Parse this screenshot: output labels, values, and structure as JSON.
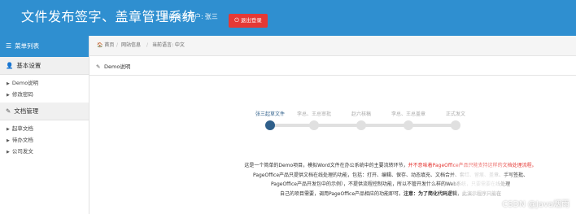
{
  "header": {
    "title": "文件发布签字、盖章管理系统",
    "user_label": "当前登录用户:",
    "user_name": "张三",
    "logout_label": "退出登录"
  },
  "sidebar": {
    "menu_title": "菜单列表",
    "groups": [
      {
        "title": "基本设置",
        "items": [
          "Demo说明",
          "修改密码"
        ]
      },
      {
        "title": "文档管理",
        "items": [
          "起草文档",
          "待办文档",
          "公司发文"
        ]
      }
    ]
  },
  "breadcrumb": [
    "首页",
    "网站信息",
    "当前语言: 中文"
  ],
  "panel": {
    "title": "Demo说明"
  },
  "steps": {
    "labels": [
      "张三起草文件",
      "李总、王总审批",
      "赵六核稿",
      "李总、王总盖章",
      "正式发文"
    ],
    "current": 0
  },
  "description": {
    "line1_a": "这是一个简单的Demo项目，模拟Word文件在办公系统中的主要流转环节，",
    "line1_b": "并不意味着PageOffice产品只能支持这样的文档处理流程。",
    "line2": "PageOffice产品只提供文档在线处理的功能，包括：打开、编辑、保存、动态填充、文档合并、套红、留痕、盖章、手写签批、",
    "line3": "PageOffice产品开发包中的示例），不提供流程控制功能，所以不管开发什么样的Web系统，只要需要在线处理",
    "line4_a": "自己的项目需要，调用PageOffice产品相应的功能即可。",
    "line4_b": "注意：为了简化代码逻辑，此演示程序只能在"
  },
  "watermark": "CSDN @Java烟雨",
  "colors": {
    "topbar": "#2f8fd0",
    "danger": "#e53935",
    "step_active": "#2f5f8a",
    "step_inactive": "#e0e0e0"
  }
}
